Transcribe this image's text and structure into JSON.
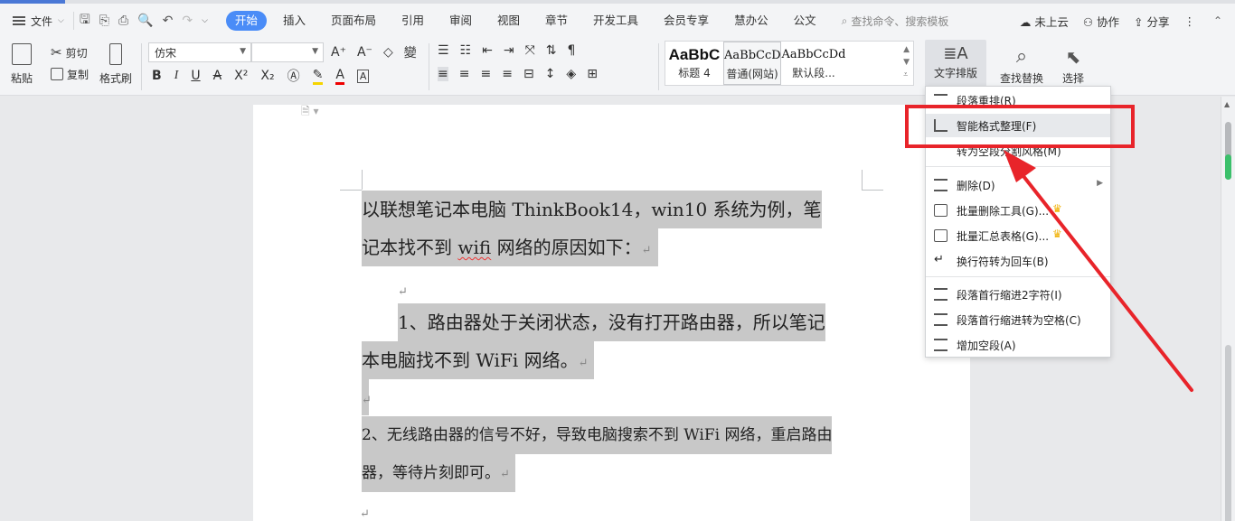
{
  "menubar": {
    "file_label": "文件",
    "tabs": [
      "开始",
      "插入",
      "页面布局",
      "引用",
      "审阅",
      "视图",
      "章节",
      "开发工具",
      "会员专享",
      "慧办公",
      "公文"
    ],
    "search_placeholder": "查找命令、搜索模板",
    "cloud_label": "未上云",
    "collab_label": "协作",
    "share_label": "分享"
  },
  "ribbon": {
    "paste_label": "粘贴",
    "cut_label": "剪切",
    "copy_label": "复制",
    "format_painter_label": "格式刷",
    "font_name": "仿宋",
    "font_size": "",
    "styles": [
      {
        "sample": "AaBbC",
        "name": "标题 4"
      },
      {
        "sample": "AaBbCcD",
        "name": "普通(网站)"
      },
      {
        "sample": "AaBbCcDd",
        "name": "默认段..."
      }
    ],
    "text_layout_label": "文字排版",
    "find_replace_label": "查找替换",
    "select_label": "选择"
  },
  "document": {
    "line1": "以联想笔记本电脑 ThinkBook14，win10 系统为例，笔",
    "line2a": "记本找不到 ",
    "line2_wifi": "wifi",
    "line2b": " 网络的原因如下：",
    "para_mark": "↵",
    "line4": "1、路由器处于关闭状态，没有打开路由器，所以笔记",
    "line5": "本电脑找不到 WiFi 网络。",
    "line7": "2、无线路由器的信号不好，导致电脑搜索不到 WiFi 网络，重启路由",
    "line8": "器，等待片刻即可。"
  },
  "dropdown": {
    "items": [
      {
        "label": "段落重排(R)"
      },
      {
        "label": "智能格式整理(F)"
      },
      {
        "label": "转为空段分割风格(M)"
      },
      {
        "label": "删除(D)"
      },
      {
        "label": "批量删除工具(G)..."
      },
      {
        "label": "批量汇总表格(G)..."
      },
      {
        "label": "换行符转为回车(B)"
      },
      {
        "label": "段落首行缩进2字符(I)"
      },
      {
        "label": "段落首行缩进转为空格(C)"
      },
      {
        "label": "增加空段(A)"
      }
    ]
  },
  "colors": {
    "accent_tab": "#4a8cf7",
    "highlight_box": "#e8242a",
    "selection_gray": "#c8c8c8"
  }
}
